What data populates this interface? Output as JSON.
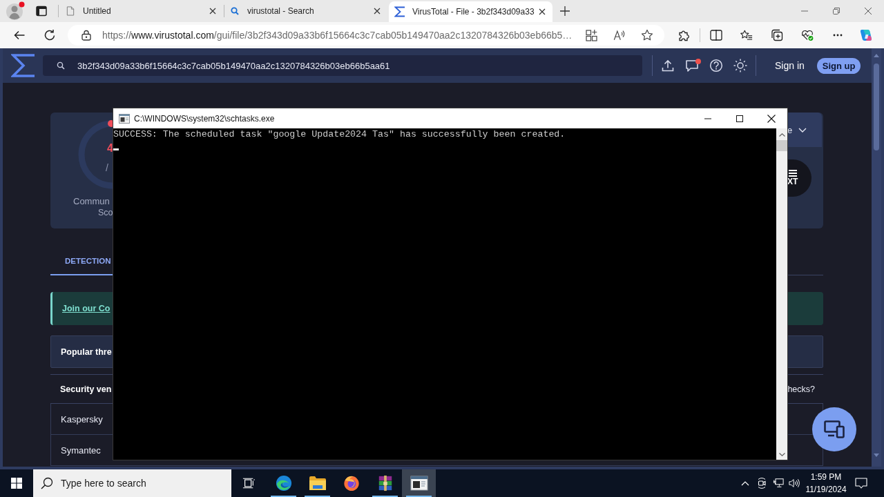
{
  "browser": {
    "tabs": [
      {
        "kind": "page",
        "title": "Untitled",
        "selected": false
      },
      {
        "kind": "search",
        "title": "virustotal - Search",
        "selected": false
      },
      {
        "kind": "site",
        "title": "VirusTotal - File - 3b2f343d09a33",
        "selected": true
      }
    ],
    "address": {
      "scheme": "https://",
      "host": "www.virustotal.com",
      "path": "/gui/file/3b2f343d09a33b6f15664c3c7cab05b149470aa2c1320784326b03eb66b5…"
    }
  },
  "site_header": {
    "search": {
      "value": "3b2f343d09a33b6f15664c3c7cab05b149470aa2c1320784326b03eb66b5aa61"
    },
    "notification_dot": true,
    "sign_in": "Sign in",
    "sign_up": "Sign up"
  },
  "summary": {
    "score": "4",
    "score_total": "/",
    "label_lines": [
      "Commun",
      "Sco"
    ],
    "button_label": "e",
    "file_type_label": "XT"
  },
  "tabs": [
    {
      "label": "DETECTION",
      "selected": true
    }
  ],
  "banner": {
    "link": "Join our Co"
  },
  "popular_threat": {
    "label": "Popular thre"
  },
  "vendors": {
    "heading": "Security ven",
    "aside": "hecks?",
    "rows": [
      "Kaspersky",
      "Symantec"
    ]
  },
  "console": {
    "title": "C:\\WINDOWS\\system32\\schtasks.exe",
    "lines": [
      "SUCCESS: The scheduled task \"google Update2024 Tas\" has successfully been created."
    ],
    "cursor": true
  },
  "taskbar": {
    "search": {
      "placeholder": "Type here to search"
    },
    "apps": [
      {
        "kind": "edge",
        "running": true,
        "selected": false
      },
      {
        "kind": "explorer",
        "running": true,
        "selected": false
      },
      {
        "kind": "firefox",
        "running": false,
        "selected": false
      },
      {
        "kind": "winrar",
        "running": true,
        "selected": false
      },
      {
        "kind": "console",
        "running": true,
        "selected": true
      }
    ],
    "time": "1:59 PM",
    "date": "11/19/2024"
  }
}
